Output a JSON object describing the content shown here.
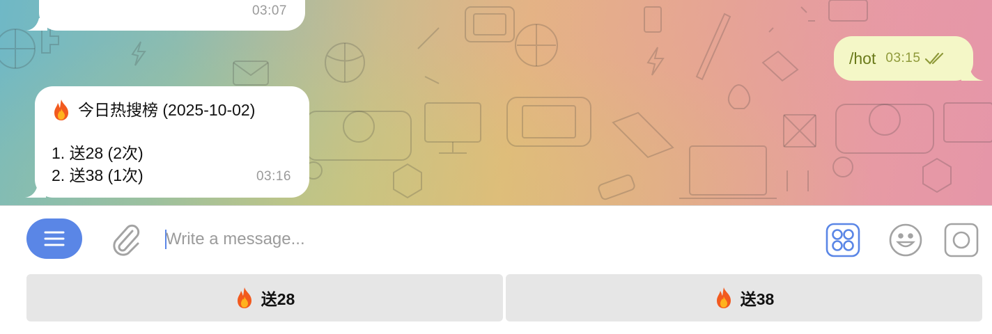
{
  "messages": {
    "previous": {
      "time": "03:07"
    },
    "outgoing": {
      "text": "/hot",
      "time": "03:15"
    },
    "hot_list": {
      "title": "今日热搜榜 (2025-10-02)",
      "items": [
        "1. 送28 (2次)",
        "2. 送38 (1次)"
      ],
      "time": "03:16"
    }
  },
  "composer": {
    "placeholder": "Write a message..."
  },
  "keyboard": {
    "buttons": [
      "送28",
      "送38"
    ]
  },
  "icons": {
    "menu": "menu-icon",
    "attach": "paperclip-icon",
    "apps": "apps-grid-icon",
    "emoji": "emoji-icon",
    "record": "record-icon",
    "fire": "fire-icon",
    "read": "double-check-icon"
  },
  "colors": {
    "accent": "#5a86e6",
    "outgoing_bubble": "#f4f7c7",
    "keyboard_button": "#e6e6e6"
  }
}
